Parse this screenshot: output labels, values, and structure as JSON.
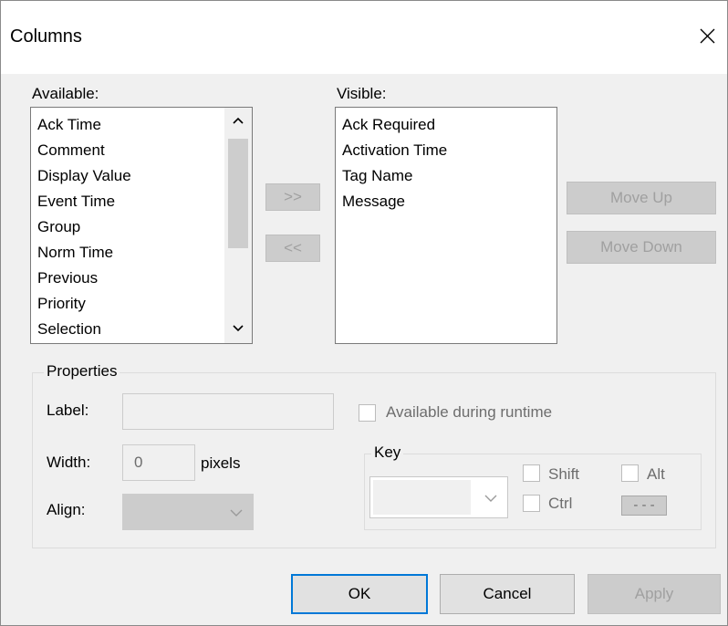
{
  "window": {
    "title": "Columns"
  },
  "available": {
    "label": "Available:",
    "items": [
      "Ack Time",
      "Comment",
      "Display Value",
      "Event Time",
      "Group",
      "Norm Time",
      "Previous",
      "Priority",
      "Selection"
    ]
  },
  "visible": {
    "label": "Visible:",
    "items": [
      "Ack Required",
      "Activation Time",
      "Tag Name",
      "Message"
    ]
  },
  "transfer": {
    "add_label": ">>",
    "remove_label": "<<"
  },
  "order": {
    "move_up_label": "Move Up",
    "move_down_label": "Move Down"
  },
  "properties": {
    "title": "Properties",
    "label_caption": "Label:",
    "label_value": "",
    "width_caption": "Width:",
    "width_value": "0",
    "width_unit": "pixels",
    "align_caption": "Align:",
    "align_value": "",
    "runtime_label": "Available during runtime",
    "key": {
      "title": "Key",
      "selected": "",
      "shift_label": "Shift",
      "alt_label": "Alt",
      "ctrl_label": "Ctrl",
      "hotkey_value": "- - -"
    }
  },
  "footer": {
    "ok_label": "OK",
    "cancel_label": "Cancel",
    "apply_label": "Apply"
  }
}
